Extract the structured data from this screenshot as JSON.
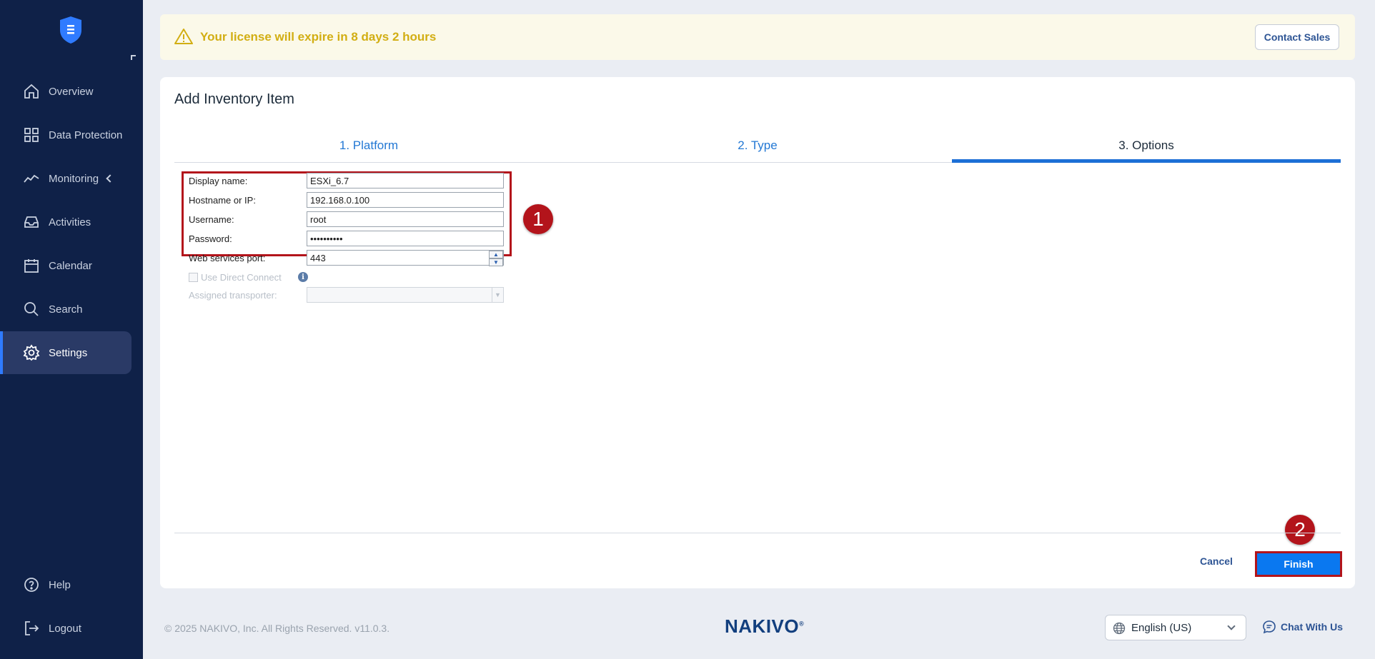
{
  "sidebar": {
    "logo_icon": "shield-logo-icon",
    "items": [
      {
        "label": "Overview",
        "icon": "home-icon"
      },
      {
        "label": "Data Protection",
        "icon": "grid-icon"
      },
      {
        "label": "Monitoring",
        "icon": "activity-icon"
      },
      {
        "label": "Activities",
        "icon": "inbox-icon"
      },
      {
        "label": "Calendar",
        "icon": "calendar-icon"
      },
      {
        "label": "Search",
        "icon": "search-icon"
      },
      {
        "label": "Settings",
        "icon": "gear-icon",
        "active": true
      }
    ],
    "bottom": [
      {
        "label": "Help",
        "icon": "help-icon"
      },
      {
        "label": "Logout",
        "icon": "logout-icon"
      }
    ]
  },
  "banner": {
    "text": "Your license will expire in 8 days 2 hours",
    "contact_label": "Contact Sales",
    "color": "#d2ae13"
  },
  "dialog": {
    "title": "Add Inventory Item",
    "tabs": [
      {
        "label": "1. Platform"
      },
      {
        "label": "2. Type"
      },
      {
        "label": "3. Options",
        "active": true
      }
    ],
    "fields": {
      "display_name": {
        "label": "Display name:",
        "value": "ESXi_6.7"
      },
      "hostname": {
        "label": "Hostname or IP:",
        "value": "192.168.0.100"
      },
      "username": {
        "label": "Username:",
        "value": "root"
      },
      "password": {
        "label": "Password:",
        "value": "••••••••••"
      },
      "port": {
        "label": "Web services port:",
        "value": "443"
      },
      "direct_connect": {
        "label": "Use Direct Connect",
        "checked": false
      },
      "transporter": {
        "label": "Assigned transporter:",
        "value": ""
      }
    },
    "annotations": [
      "1",
      "2"
    ],
    "cancel_label": "Cancel",
    "finish_label": "Finish"
  },
  "footer": {
    "copyright": "© 2025 NAKIVO, Inc. All Rights Reserved. v11.0.3.",
    "brand": "NAKIVO",
    "brand_mark": "®",
    "language": "English (US)",
    "chat_label": "Chat With Us"
  },
  "colors": {
    "sidebar_bg": "#0f2148",
    "accent": "#0a78f0",
    "highlight": "#b3141b"
  }
}
